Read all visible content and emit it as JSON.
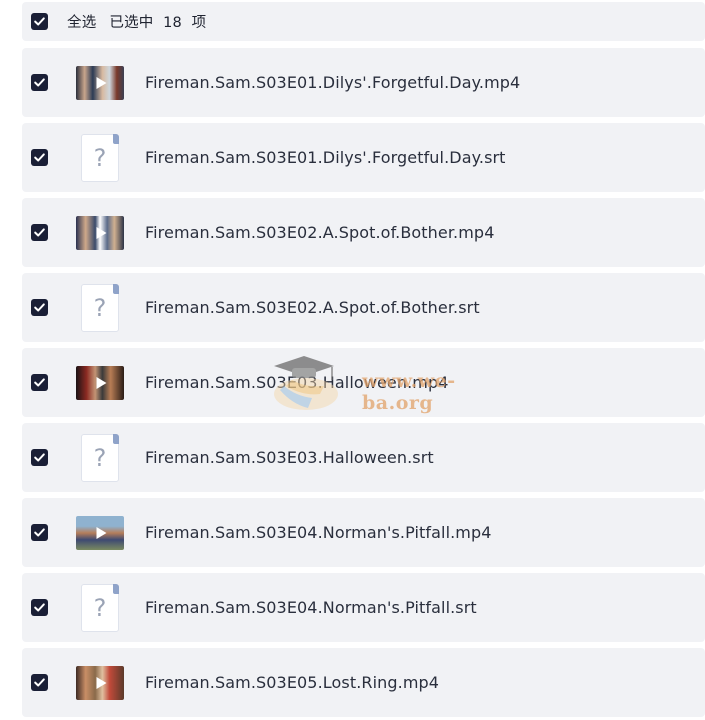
{
  "header": {
    "select_all_label": "全选",
    "selected_text": "已选中  18  项",
    "select_all_checked": true
  },
  "files": [
    {
      "name": "Fireman.Sam.S03E01.Dilys'.Forgetful.Day.mp4",
      "type": "video",
      "checked": true
    },
    {
      "name": "Fireman.Sam.S03E01.Dilys'.Forgetful.Day.srt",
      "type": "unknown",
      "checked": true
    },
    {
      "name": "Fireman.Sam.S03E02.A.Spot.of.Bother.mp4",
      "type": "video",
      "checked": true
    },
    {
      "name": "Fireman.Sam.S03E02.A.Spot.of.Bother.srt",
      "type": "unknown",
      "checked": true
    },
    {
      "name": "Fireman.Sam.S03E03.Halloween.mp4",
      "type": "video",
      "checked": true
    },
    {
      "name": "Fireman.Sam.S03E03.Halloween.srt",
      "type": "unknown",
      "checked": true
    },
    {
      "name": "Fireman.Sam.S03E04.Norman's.Pitfall.mp4",
      "type": "video",
      "checked": true
    },
    {
      "name": "Fireman.Sam.S03E04.Norman's.Pitfall.srt",
      "type": "unknown",
      "checked": true
    },
    {
      "name": "Fireman.Sam.S03E05.Lost.Ring.mp4",
      "type": "video",
      "checked": true
    }
  ],
  "unknown_file_glyph": "?",
  "watermark": {
    "text": "www.we-ba.org",
    "icon": "graduation-cap-books-icon"
  },
  "colors": {
    "checkbox": "#1a1f36",
    "row_background": "#f1f2f5",
    "text": "#2a2f3d",
    "watermark": "#e2a26a"
  }
}
